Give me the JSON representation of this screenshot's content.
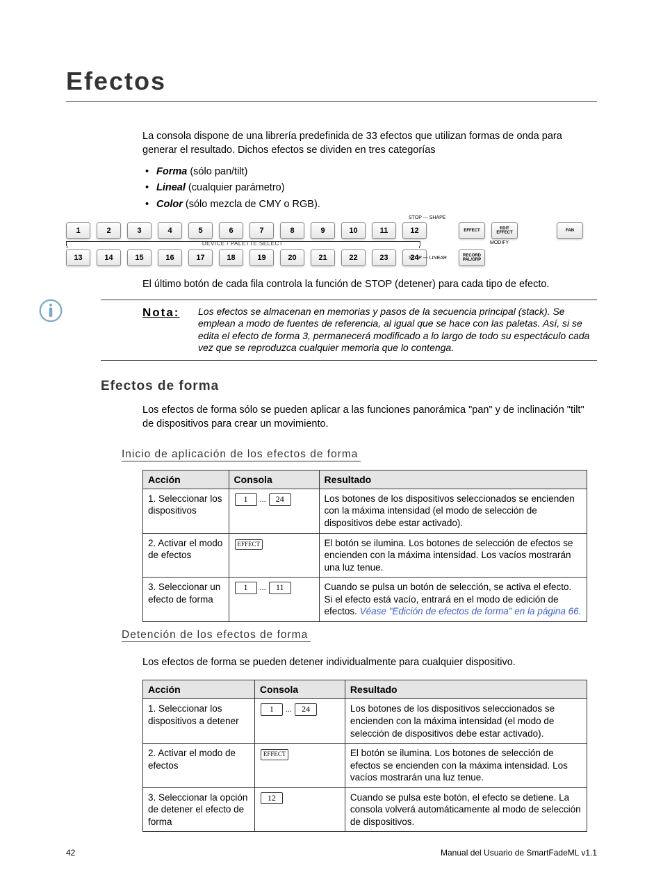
{
  "page": {
    "title": "Efectos",
    "intro": "La consola dispone de una librería predefinida de 33 efectos que utilizan formas de onda para generar el resultado. Dichos efectos se dividen en tres categorías",
    "bullets": [
      {
        "term": "Forma",
        "rest": " (sólo pan/tilt)"
      },
      {
        "term": "Lineal",
        "rest": " (cualquier parámetro)"
      },
      {
        "term": "Color",
        "rest": " (sólo mezcla de CMY o RGB)."
      }
    ],
    "stopNote": "El último botón de cada fila controla la función de STOP (detener) para cada tipo de efecto.",
    "note": {
      "label": "Nota:",
      "text": "Los efectos se almacenan en memorias y pasos de la secuencia principal (stack). Se emplean a modo de fuentes de referencia, al igual que se hace con las paletas. Así, si se edita el efecto de forma 3, permanecerá modificado a lo largo de todo su espectáculo cada vez que se reproduzca cualquier memoria que lo contenga."
    }
  },
  "diagram": {
    "row1": [
      "1",
      "2",
      "3",
      "4",
      "5",
      "6",
      "7",
      "8",
      "9",
      "10",
      "11",
      "12"
    ],
    "row2": [
      "13",
      "14",
      "15",
      "16",
      "17",
      "18",
      "19",
      "20",
      "21",
      "22",
      "23",
      "24"
    ],
    "midLabel": "DEVICE / PALETTE SELECT",
    "stopShape": "STOP --- SHAPE",
    "stopLinear": "STOP --- LINEAR",
    "rightTop": [
      "EFFECT",
      "EDIT EFFECT",
      "FAN"
    ],
    "rightModify": "MODIFY",
    "rightBottom": "RECORD PAL/GRP"
  },
  "shape": {
    "heading": "Efectos de forma",
    "intro": "Los efectos de forma sólo se pueden aplicar a las funciones panorámica \"pan\" y de inclinación \"tilt\" de dispositivos para crear un movimiento.",
    "start": {
      "heading": "Inicio de aplicación de los efectos de forma",
      "headers": [
        "Acción",
        "Consola",
        "Resultado"
      ],
      "rows": [
        {
          "action": "1. Seleccionar los dispositivos",
          "console": {
            "type": "range",
            "a": "1",
            "b": "24"
          },
          "result": "Los botones de los dispositivos seleccionados se encienden con la máxima intensidad (el modo de selección de dispositivos debe estar activado)."
        },
        {
          "action": "2. Activar el modo de efectos",
          "console": {
            "type": "btn",
            "label": "EFFECT"
          },
          "result": "El botón se ilumina. Los botones de selección de efectos se encienden con la máxima intensidad. Los vacíos mostrarán una luz tenue."
        },
        {
          "action": "3. Seleccionar un efecto de forma",
          "console": {
            "type": "range",
            "a": "1",
            "b": "11"
          },
          "result": "Cuando se pulsa un botón de selección, se activa el efecto. Si el efecto está vacío, entrará en el modo de edición de efectos. ",
          "link": "Véase \"Edición de efectos de forma\" en la página  66.",
          "linkAfter": ""
        }
      ]
    },
    "stop": {
      "heading": "Detención de los efectos de forma",
      "intro": "Los efectos de forma se pueden detener individualmente para cualquier dispositivo.",
      "headers": [
        "Acción",
        "Consola",
        "Resultado"
      ],
      "rows": [
        {
          "action": "1. Seleccionar los dispositivos a detener",
          "console": {
            "type": "range",
            "a": "1",
            "b": "24"
          },
          "result": "Los botones de los dispositivos seleccionados se encienden con la máxima intensidad (el modo de selección de dispositivos debe estar activado)."
        },
        {
          "action": "2. Activar el modo de efectos",
          "console": {
            "type": "btn",
            "label": "EFFECT"
          },
          "result": "El botón se ilumina. Los botones de selección de efectos se encienden con la máxima intensidad. Los vacíos mostrarán una luz tenue."
        },
        {
          "action": "3. Seleccionar la opción de detener el efecto de forma",
          "console": {
            "type": "single",
            "a": "12"
          },
          "result": "Cuando se pulsa este botón, el efecto se detiene. La consola volverá automáticamente al modo de selección de dispositivos."
        }
      ]
    }
  },
  "footer": {
    "pageNum": "42",
    "docTitle": "Manual del Usuario de SmartFadeML v1.1"
  }
}
